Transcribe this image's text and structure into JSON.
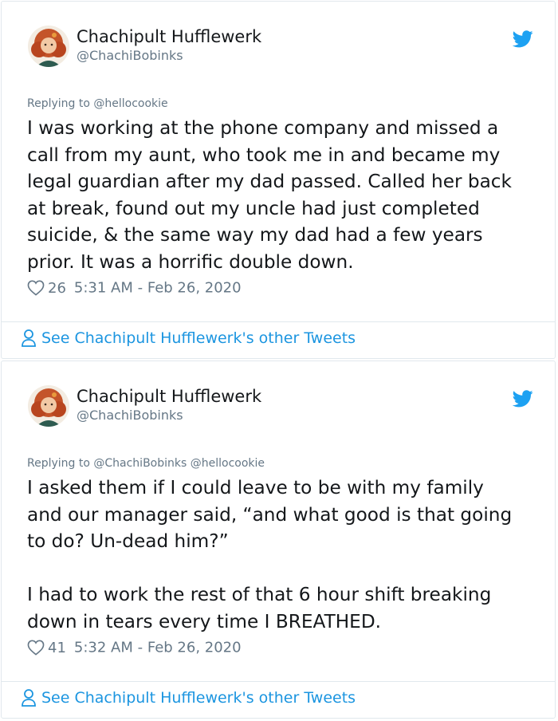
{
  "colors": {
    "link": "#1b95e0",
    "muted": "#657786",
    "border": "#e1e8ed",
    "text": "#14171a"
  },
  "tweets": [
    {
      "author_name": "Chachipult Hufflewerk",
      "author_handle": "@ChachiBobinks",
      "replying_to": "Replying to @hellocookie",
      "text": "I was working at the phone company and missed a\ncall from my aunt, who took me in and became my\nlegal guardian after my dad passed. Called her back\nat break, found out my uncle had just completed\nsuicide, & the same way my dad had a few years\nprior. It was a horrific double down.",
      "likes": "26",
      "timestamp": "5:31 AM - Feb 26, 2020",
      "see_more": "See Chachipult Hufflewerk's other Tweets",
      "icons": {
        "avatar": "avatar",
        "platform": "twitter-bird-icon",
        "like": "heart-icon",
        "profile": "person-icon"
      }
    },
    {
      "author_name": "Chachipult Hufflewerk",
      "author_handle": "@ChachiBobinks",
      "replying_to": "Replying to @ChachiBobinks @hellocookie",
      "text": "I asked them if I could leave to be with my family\nand our manager said, “and what good is that going\nto do? Un-dead him?”\n\nI had to work the rest of that 6 hour shift breaking\ndown in tears every time I BREATHED.",
      "likes": "41",
      "timestamp": "5:32 AM - Feb 26, 2020",
      "see_more": "See Chachipult Hufflewerk's other Tweets",
      "icons": {
        "avatar": "avatar",
        "platform": "twitter-bird-icon",
        "like": "heart-icon",
        "profile": "person-icon"
      }
    }
  ]
}
